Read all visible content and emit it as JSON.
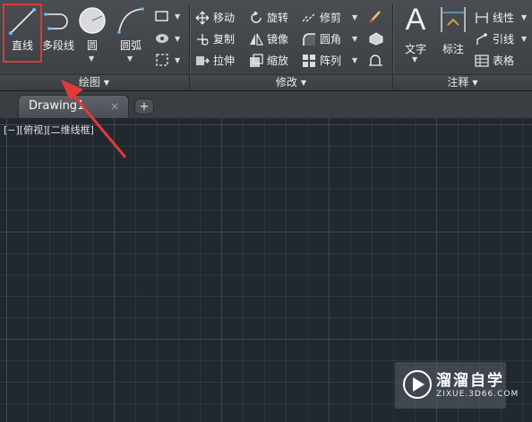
{
  "ribbon": {
    "draw_panel": {
      "label": "绘图",
      "line": "直线",
      "polyline": "多段线",
      "circle": "圆",
      "arc": "圆弧"
    },
    "modify_panel": {
      "label": "修改",
      "move": "移动",
      "rotate": "旋转",
      "trim": "修剪",
      "copy": "复制",
      "mirror": "镜像",
      "fillet": "圆角",
      "stretch": "拉伸",
      "scale": "缩放",
      "array": "阵列"
    },
    "annotation_panel": {
      "label": "注释",
      "text": "文字",
      "dimension": "标注",
      "linear": "线性",
      "leader": "引线",
      "table": "表格"
    }
  },
  "tabs": {
    "active": "Drawing1",
    "close": "×",
    "new": "+"
  },
  "viewport": {
    "label": "[−][俯视][二维线框]"
  },
  "watermark": {
    "name": "溜溜自学",
    "url": "ZIXUE.3D66.COM"
  },
  "colors": {
    "highlight": "#d83a3a",
    "canvas": "#212830",
    "ribbon": "#3f4247"
  }
}
